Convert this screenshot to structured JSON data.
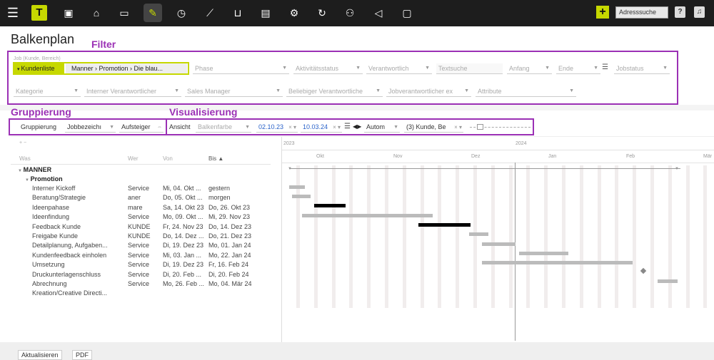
{
  "topbar": {
    "search_placeholder": "Adresssuche",
    "help": "?",
    "logo": "T",
    "icons": [
      "menu-icon",
      "logo-icon",
      "calendar-icon",
      "address-icon",
      "folder-icon",
      "task-icon",
      "clock-icon",
      "chart-icon",
      "cart-icon",
      "document-icon",
      "gear-icon",
      "refresh-icon",
      "people-icon",
      "megaphone-icon",
      "chat-icon"
    ]
  },
  "page": {
    "title": "Balkenplan"
  },
  "annotations": {
    "filter": "Filter",
    "gruppierung": "Gruppierung",
    "visualisierung": "Visualisierung"
  },
  "filter": {
    "job_label": "Job (Kunde, Bereich)",
    "kundenliste": "Kundenliste",
    "job_value": "Manner › Promotion › Die blau...",
    "phase": "Phase",
    "aktivitaetsstatus": "Aktivitätsstatus",
    "verantwortlich": "Verantwortlich",
    "textsuche": "Textsuche",
    "anfang": "Anfang",
    "ende": "Ende",
    "jobstatus": "Jobstatus",
    "kategorie": "Kategorie",
    "interner_verantwortlicher": "Interner Verantwortlicher",
    "sales_manager": "Sales Manager",
    "beliebiger_verantwortlicher": "Beliebiger Verantwortliche",
    "jobverantwortlicher": "Jobverantwortlicher ex",
    "attribute": "Attribute"
  },
  "grouping": {
    "label": "Gruppierung",
    "value": "Jobbezeichı",
    "sort": "Aufsteiger"
  },
  "visual": {
    "ansicht": "Ansicht",
    "balkenfarbe": "Balkenfarbe",
    "start": "02.10.23",
    "end": "10.03.24",
    "auto": "Autom",
    "level": "(3) Kunde, Be"
  },
  "table": {
    "headers": {
      "was": "Was",
      "wer": "Wer",
      "von": "Von",
      "bis": "Bis ▲"
    },
    "group1": "MANNER",
    "group2": "Promotion",
    "rows": [
      {
        "was": "Interner Kickoff",
        "wer": "Service",
        "von": "Mi, 04. Okt ...",
        "bis": "gestern"
      },
      {
        "was": "Beratung/Strategie",
        "wer": "aner",
        "von": "Do, 05. Okt ...",
        "bis": "morgen"
      },
      {
        "was": "Ideenpahase",
        "wer": "mare",
        "von": "Sa, 14. Okt 23",
        "bis": "Do, 26. Okt 23"
      },
      {
        "was": "Ideenfindung",
        "wer": "Service",
        "von": "Mo, 09. Okt ...",
        "bis": "Mi, 29. Nov 23"
      },
      {
        "was": "Feedback Kunde",
        "wer": "KUNDE",
        "von": "Fr, 24. Nov 23",
        "bis": "Do, 14. Dez 23"
      },
      {
        "was": "Freigabe Kunde",
        "wer": "KUNDE",
        "von": "Do, 14. Dez ...",
        "bis": "Do, 21. Dez 23"
      },
      {
        "was": "Detailplanung, Aufgaben...",
        "wer": "Service",
        "von": "Di, 19. Dez 23",
        "bis": "Mo, 01. Jan 24"
      },
      {
        "was": "Kundenfeedback einholen",
        "wer": "Service",
        "von": "Mi, 03. Jan ...",
        "bis": "Mo, 22. Jan 24"
      },
      {
        "was": "Umsetzung",
        "wer": "Service",
        "von": "Di, 19. Dez 23",
        "bis": "Fr, 16. Feb 24"
      },
      {
        "was": "Druckunterlagenschluss",
        "wer": "Service",
        "von": "Di, 20. Feb ...",
        "bis": "Di, 20. Feb 24"
      },
      {
        "was": "Abrechnung",
        "wer": "Service",
        "von": "Mo, 26. Feb ...",
        "bis": "Mo, 04. Mär 24"
      },
      {
        "was": "Kreation/Creative Directi...",
        "wer": "",
        "von": "",
        "bis": ""
      }
    ]
  },
  "timeline": {
    "years": [
      "2023",
      "2024"
    ],
    "months": [
      "Okt",
      "Nov",
      "Dez",
      "Jan",
      "Feb",
      "Mär"
    ]
  },
  "footer": {
    "aktualisieren": "Aktualisieren",
    "pdf": "PDF"
  }
}
